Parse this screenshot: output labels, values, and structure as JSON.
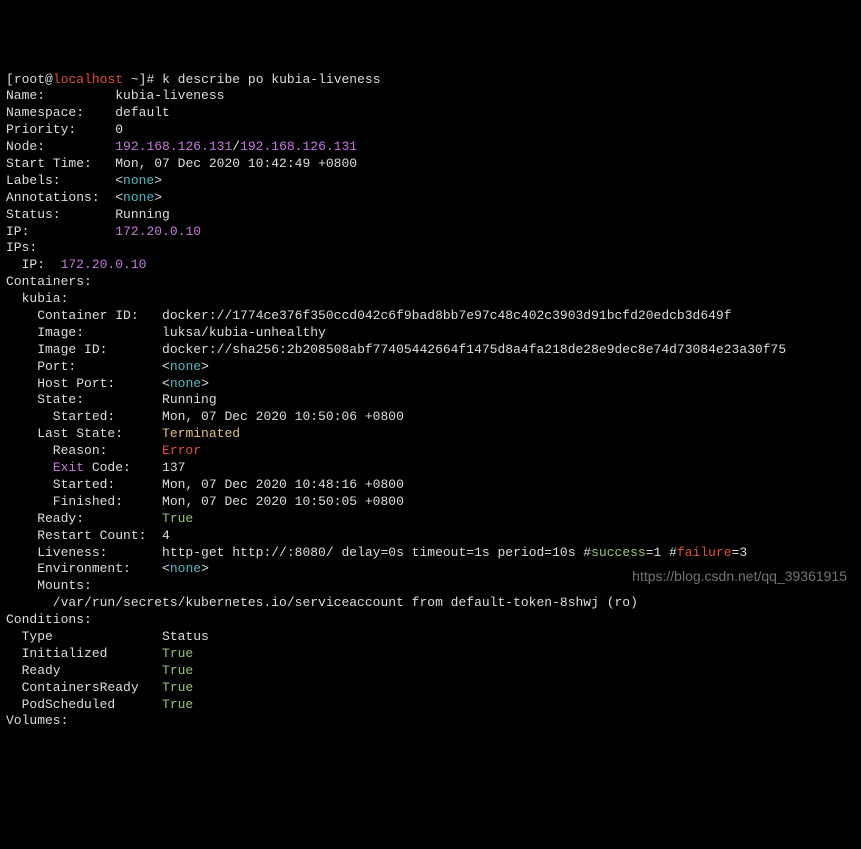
{
  "prompt": {
    "user": "root",
    "at": "@",
    "host": "localhost",
    "rest": " ~]# ",
    "cmd": "k describe po kubia-liveness"
  },
  "fields": {
    "name_label": "Name:",
    "name_value": "kubia-liveness",
    "namespace_label": "Namespace:",
    "namespace_value": "default",
    "priority_label": "Priority:",
    "priority_value": "0",
    "node_label": "Node:",
    "node_ip1": "192.168.126.131",
    "node_slash": "/",
    "node_ip2": "192.168.126.131",
    "starttime_label": "Start Time:",
    "starttime_value": "Mon, 07 Dec 2020 10:42:49 +0800",
    "labels_label": "Labels:",
    "annotations_label": "Annotations:",
    "none_open": "<",
    "none_text": "none",
    "none_close": ">",
    "status_label": "Status:",
    "status_value": "Running",
    "ip_label": "IP:",
    "ip_value": "172.20.0.10",
    "ips_label": "IPs:",
    "ips_sub_label": "  IP:  ",
    "ips_sub_value": "172.20.0.10"
  },
  "containers": {
    "header": "Containers:",
    "name": "  kubia:",
    "cid_label": "    Container ID:",
    "cid_value": "docker://1774ce376f350ccd042c6f9bad8bb7e97c48c402c3903d91bcfd20edcb3d649f",
    "image_label": "    Image:",
    "image_value": "luksa/kubia-unhealthy",
    "imageid_label": "    Image ID:",
    "imageid_value": "docker://sha256:2b208508abf77405442664f1475d8a4fa218de28e9dec8e74d73084e23a30f75",
    "port_label": "    Port:",
    "hostport_label": "    Host Port:",
    "state_label": "    State:",
    "state_value": "Running",
    "started_label": "      Started:",
    "started_value": "Mon, 07 Dec 2020 10:50:06 +0800",
    "laststate_label": "    Last State:",
    "laststate_value": "Terminated",
    "reason_label": "      Reason:",
    "reason_value": "Error",
    "exit_label_pre": "      ",
    "exit_label_word": "Exit",
    "exit_label_post": " Code:",
    "exit_value": "137",
    "ls_started_label": "      Started:",
    "ls_started_value": "Mon, 07 Dec 2020 10:48:16 +0800",
    "ls_finished_label": "      Finished:",
    "ls_finished_value": "Mon, 07 Dec 2020 10:50:05 +0800",
    "ready_label": "    Ready:",
    "ready_value": "True",
    "restart_label": "    Restart Count:",
    "restart_value": "4",
    "liveness_label": "    Liveness:",
    "liveness_pre": "http-get http://:8080/ delay=0s timeout=1s period=10s #",
    "liveness_success": "success",
    "liveness_mid": "=1 #",
    "liveness_failure": "failure",
    "liveness_post": "=3",
    "env_label": "    Environment:",
    "mounts_label": "    Mounts:",
    "mounts_value": "      /var/run/secrets/kubernetes.io/serviceaccount from default-token-8shwj (ro)"
  },
  "conditions": {
    "header": "Conditions:",
    "type_label": "  Type",
    "status_label": "Status",
    "rows": {
      "r0l": "  Initialized",
      "r0v": "True",
      "r1l": "  Ready",
      "r1v": "True",
      "r2l": "  ContainersReady",
      "r2v": "True",
      "r3l": "  PodScheduled",
      "r3v": "True"
    }
  },
  "volumes_label": "Volumes:",
  "watermark": "https://blog.csdn.net/qq_39361915"
}
